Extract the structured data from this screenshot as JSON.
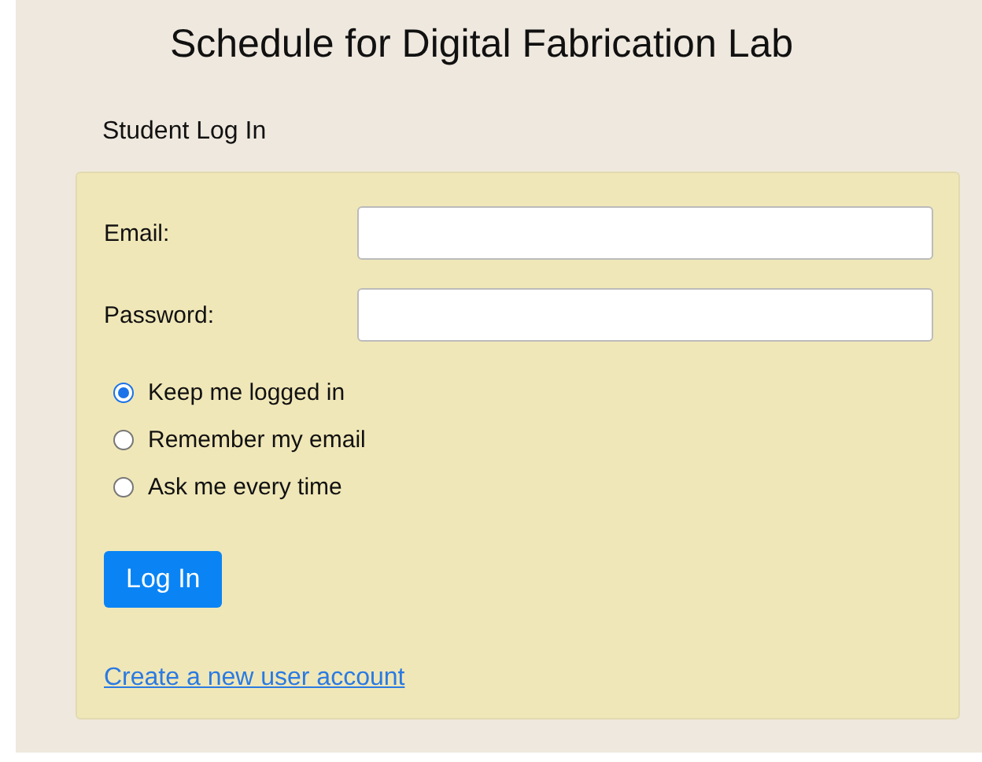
{
  "title": "Schedule for Digital Fabrication Lab",
  "section_title": "Student Log In",
  "fields": [
    {
      "label": "Email:"
    },
    {
      "label": "Password:"
    }
  ],
  "options": [
    {
      "label": "Keep me logged in",
      "selected": true
    },
    {
      "label": "Remember my email",
      "selected": false
    },
    {
      "label": "Ask me every time",
      "selected": false
    }
  ],
  "button": "Log In",
  "link": "Create a new user account"
}
